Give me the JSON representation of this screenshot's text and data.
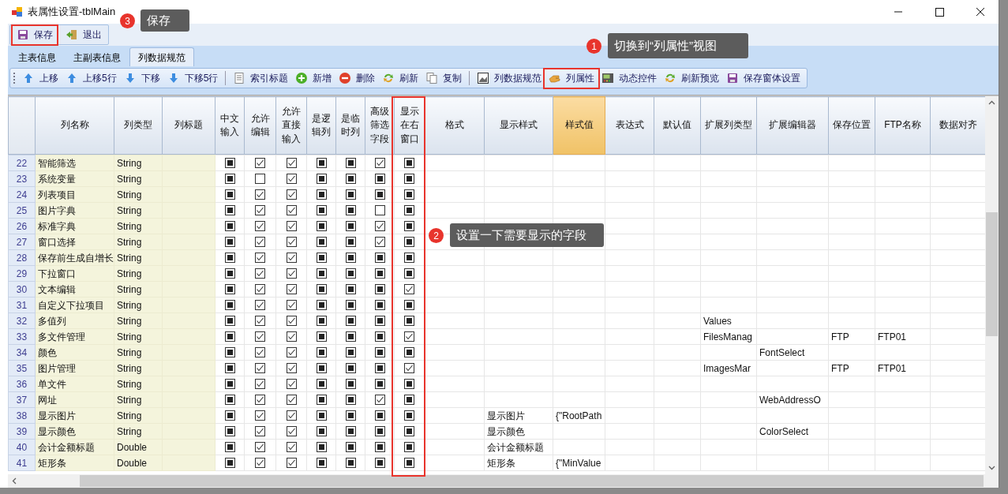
{
  "window": {
    "title": "表属性设置-tblMain"
  },
  "main_toolbar": [
    {
      "label": "保存",
      "kind": "save",
      "highlighted": true
    },
    {
      "label": "退出",
      "kind": "exit",
      "highlighted": false
    }
  ],
  "tabs": [
    {
      "label": "主表信息",
      "selected": false
    },
    {
      "label": "主副表信息",
      "selected": false
    },
    {
      "label": "列数据规范",
      "selected": true
    }
  ],
  "toolbar": [
    {
      "label": "上移",
      "kind": "up",
      "highlighted": false
    },
    {
      "label": "上移5行",
      "kind": "up",
      "highlighted": false
    },
    {
      "label": "下移",
      "kind": "down",
      "highlighted": false
    },
    {
      "label": "下移5行",
      "kind": "down",
      "highlighted": false
    },
    {
      "kind": "separator"
    },
    {
      "label": "索引标题",
      "kind": "doc",
      "highlighted": false
    },
    {
      "label": "新增",
      "kind": "add",
      "highlighted": false
    },
    {
      "label": "删除",
      "kind": "delete",
      "highlighted": false
    },
    {
      "label": "刷新",
      "kind": "refresh",
      "highlighted": false
    },
    {
      "label": "复制",
      "kind": "copy",
      "highlighted": false
    },
    {
      "kind": "separator"
    },
    {
      "label": "列数据规范",
      "kind": "grid",
      "highlighted": false
    },
    {
      "label": "列属性",
      "kind": "hand",
      "highlighted": true
    },
    {
      "label": "动态控件",
      "kind": "panel",
      "highlighted": false
    },
    {
      "label": "刷新预览",
      "kind": "refresh",
      "highlighted": false
    },
    {
      "label": "保存窗体设置",
      "kind": "save",
      "highlighted": false
    }
  ],
  "table": {
    "columns": [
      {
        "label": "列名称",
        "kind": "name",
        "selected": false,
        "highlighted": false
      },
      {
        "label": "列类型",
        "kind": "type",
        "selected": false,
        "highlighted": false
      },
      {
        "label": "列标题",
        "kind": "title",
        "selected": false,
        "highlighted": false
      },
      {
        "label": "中文输入",
        "kind": "check",
        "selected": false,
        "highlighted": false
      },
      {
        "label": "允许编辑",
        "kind": "check",
        "selected": false,
        "highlighted": false
      },
      {
        "label": "允许直接输入",
        "kind": "check",
        "selected": false,
        "highlighted": false
      },
      {
        "label": "是逻辑列",
        "kind": "check",
        "selected": false,
        "highlighted": false
      },
      {
        "label": "是临时列",
        "kind": "check",
        "selected": false,
        "highlighted": false
      },
      {
        "label": "高级筛选字段",
        "kind": "check",
        "selected": false,
        "highlighted": false
      },
      {
        "label": "显示在右窗口",
        "kind": "check",
        "selected": false,
        "highlighted": true
      },
      {
        "label": "格式",
        "kind": "text",
        "selected": false,
        "highlighted": false
      },
      {
        "label": "显示样式",
        "kind": "text",
        "selected": false,
        "highlighted": false
      },
      {
        "label": "样式值",
        "kind": "text",
        "selected": true,
        "highlighted": false
      },
      {
        "label": "表达式",
        "kind": "text",
        "selected": false,
        "highlighted": false
      },
      {
        "label": "默认值",
        "kind": "text",
        "selected": false,
        "highlighted": false
      },
      {
        "label": "扩展列类型",
        "kind": "text",
        "selected": false,
        "highlighted": false
      },
      {
        "label": "扩展编辑器",
        "kind": "text",
        "selected": false,
        "highlighted": false
      },
      {
        "label": "保存位置",
        "kind": "text",
        "selected": false,
        "highlighted": false
      },
      {
        "label": "FTP名称",
        "kind": "text",
        "selected": false,
        "highlighted": false
      },
      {
        "label": "数据对齐",
        "kind": "text",
        "selected": false,
        "highlighted": false
      }
    ],
    "rows": [
      {
        "number": "22",
        "name": "智能筛选",
        "type": "String",
        "checks": [
          {
            "checked": false,
            "indeterminate": true
          },
          {
            "checked": true,
            "indeterminate": false
          },
          {
            "checked": true,
            "indeterminate": false
          },
          {
            "checked": false,
            "indeterminate": true
          },
          {
            "checked": false,
            "indeterminate": true
          },
          {
            "checked": true,
            "indeterminate": false
          },
          {
            "checked": false,
            "indeterminate": true
          }
        ]
      },
      {
        "number": "23",
        "name": "系统变量",
        "type": "String",
        "checks": [
          {
            "checked": false,
            "indeterminate": true
          },
          {
            "checked": false,
            "indeterminate": false
          },
          {
            "checked": true,
            "indeterminate": false
          },
          {
            "checked": false,
            "indeterminate": true
          },
          {
            "checked": false,
            "indeterminate": true
          },
          {
            "checked": false,
            "indeterminate": true
          },
          {
            "checked": false,
            "indeterminate": true
          }
        ]
      },
      {
        "number": "24",
        "name": "列表项目",
        "type": "String",
        "checks": [
          {
            "checked": false,
            "indeterminate": true
          },
          {
            "checked": true,
            "indeterminate": false
          },
          {
            "checked": true,
            "indeterminate": false
          },
          {
            "checked": false,
            "indeterminate": true
          },
          {
            "checked": false,
            "indeterminate": true
          },
          {
            "checked": false,
            "indeterminate": true
          },
          {
            "checked": false,
            "indeterminate": true
          }
        ]
      },
      {
        "number": "25",
        "name": "图片字典",
        "type": "String",
        "checks": [
          {
            "checked": false,
            "indeterminate": true
          },
          {
            "checked": true,
            "indeterminate": false
          },
          {
            "checked": true,
            "indeterminate": false
          },
          {
            "checked": false,
            "indeterminate": true
          },
          {
            "checked": false,
            "indeterminate": true
          },
          {
            "checked": false,
            "indeterminate": false
          },
          {
            "checked": false,
            "indeterminate": true
          }
        ]
      },
      {
        "number": "26",
        "name": "标准字典",
        "type": "String",
        "checks": [
          {
            "checked": false,
            "indeterminate": true
          },
          {
            "checked": true,
            "indeterminate": false
          },
          {
            "checked": true,
            "indeterminate": false
          },
          {
            "checked": false,
            "indeterminate": true
          },
          {
            "checked": false,
            "indeterminate": true
          },
          {
            "checked": true,
            "indeterminate": false
          },
          {
            "checked": false,
            "indeterminate": true
          }
        ]
      },
      {
        "number": "27",
        "name": "窗口选择",
        "type": "String",
        "checks": [
          {
            "checked": false,
            "indeterminate": true
          },
          {
            "checked": true,
            "indeterminate": false
          },
          {
            "checked": true,
            "indeterminate": false
          },
          {
            "checked": false,
            "indeterminate": true
          },
          {
            "checked": false,
            "indeterminate": true
          },
          {
            "checked": true,
            "indeterminate": false
          },
          {
            "checked": false,
            "indeterminate": true
          }
        ]
      },
      {
        "number": "28",
        "name": "保存前生成自增长",
        "type": "String",
        "checks": [
          {
            "checked": false,
            "indeterminate": true
          },
          {
            "checked": true,
            "indeterminate": false
          },
          {
            "checked": true,
            "indeterminate": false
          },
          {
            "checked": false,
            "indeterminate": true
          },
          {
            "checked": false,
            "indeterminate": true
          },
          {
            "checked": false,
            "indeterminate": true
          },
          {
            "checked": false,
            "indeterminate": true
          }
        ]
      },
      {
        "number": "29",
        "name": "下拉窗口",
        "type": "String",
        "checks": [
          {
            "checked": false,
            "indeterminate": true
          },
          {
            "checked": true,
            "indeterminate": false
          },
          {
            "checked": true,
            "indeterminate": false
          },
          {
            "checked": false,
            "indeterminate": true
          },
          {
            "checked": false,
            "indeterminate": true
          },
          {
            "checked": false,
            "indeterminate": true
          },
          {
            "checked": false,
            "indeterminate": true
          }
        ]
      },
      {
        "number": "30",
        "name": "文本编辑",
        "type": "String",
        "checks": [
          {
            "checked": false,
            "indeterminate": true
          },
          {
            "checked": true,
            "indeterminate": false
          },
          {
            "checked": true,
            "indeterminate": false
          },
          {
            "checked": false,
            "indeterminate": true
          },
          {
            "checked": false,
            "indeterminate": true
          },
          {
            "checked": false,
            "indeterminate": true
          },
          {
            "checked": true,
            "indeterminate": false
          }
        ]
      },
      {
        "number": "31",
        "name": "自定义下拉项目",
        "type": "String",
        "checks": [
          {
            "checked": false,
            "indeterminate": true
          },
          {
            "checked": true,
            "indeterminate": false
          },
          {
            "checked": true,
            "indeterminate": false
          },
          {
            "checked": false,
            "indeterminate": true
          },
          {
            "checked": false,
            "indeterminate": true
          },
          {
            "checked": false,
            "indeterminate": true
          },
          {
            "checked": false,
            "indeterminate": true
          }
        ]
      },
      {
        "number": "32",
        "name": "多值列",
        "type": "String",
        "checks": [
          {
            "checked": false,
            "indeterminate": true
          },
          {
            "checked": true,
            "indeterminate": false
          },
          {
            "checked": true,
            "indeterminate": false
          },
          {
            "checked": false,
            "indeterminate": true
          },
          {
            "checked": false,
            "indeterminate": true
          },
          {
            "checked": false,
            "indeterminate": true
          },
          {
            "checked": false,
            "indeterminate": true
          }
        ],
        "ext_type": "Values"
      },
      {
        "number": "33",
        "name": "多文件管理",
        "type": "String",
        "checks": [
          {
            "checked": false,
            "indeterminate": true
          },
          {
            "checked": true,
            "indeterminate": false
          },
          {
            "checked": true,
            "indeterminate": false
          },
          {
            "checked": false,
            "indeterminate": true
          },
          {
            "checked": false,
            "indeterminate": true
          },
          {
            "checked": false,
            "indeterminate": true
          },
          {
            "checked": true,
            "indeterminate": false
          }
        ],
        "ext_type": "FilesManag",
        "save_location": "FTP",
        "ftp_name": "FTP01"
      },
      {
        "number": "34",
        "name": "颜色",
        "type": "String",
        "checks": [
          {
            "checked": false,
            "indeterminate": true
          },
          {
            "checked": true,
            "indeterminate": false
          },
          {
            "checked": true,
            "indeterminate": false
          },
          {
            "checked": false,
            "indeterminate": true
          },
          {
            "checked": false,
            "indeterminate": true
          },
          {
            "checked": false,
            "indeterminate": true
          },
          {
            "checked": false,
            "indeterminate": true
          }
        ],
        "ext_editor": "FontSelect"
      },
      {
        "number": "35",
        "name": "图片管理",
        "type": "String",
        "checks": [
          {
            "checked": false,
            "indeterminate": true
          },
          {
            "checked": true,
            "indeterminate": false
          },
          {
            "checked": true,
            "indeterminate": false
          },
          {
            "checked": false,
            "indeterminate": true
          },
          {
            "checked": false,
            "indeterminate": true
          },
          {
            "checked": false,
            "indeterminate": true
          },
          {
            "checked": true,
            "indeterminate": false
          }
        ],
        "ext_type": "ImagesMar",
        "save_location": "FTP",
        "ftp_name": "FTP01"
      },
      {
        "number": "36",
        "name": "单文件",
        "type": "String",
        "checks": [
          {
            "checked": false,
            "indeterminate": true
          },
          {
            "checked": true,
            "indeterminate": false
          },
          {
            "checked": true,
            "indeterminate": false
          },
          {
            "checked": false,
            "indeterminate": true
          },
          {
            "checked": false,
            "indeterminate": true
          },
          {
            "checked": false,
            "indeterminate": true
          },
          {
            "checked": false,
            "indeterminate": true
          }
        ]
      },
      {
        "number": "37",
        "name": "网址",
        "type": "String",
        "checks": [
          {
            "checked": false,
            "indeterminate": true
          },
          {
            "checked": true,
            "indeterminate": false
          },
          {
            "checked": true,
            "indeterminate": false
          },
          {
            "checked": false,
            "indeterminate": true
          },
          {
            "checked": false,
            "indeterminate": true
          },
          {
            "checked": true,
            "indeterminate": false
          },
          {
            "checked": false,
            "indeterminate": true
          }
        ],
        "ext_editor": "WebAddressO"
      },
      {
        "number": "38",
        "name": "显示图片",
        "type": "String",
        "checks": [
          {
            "checked": false,
            "indeterminate": true
          },
          {
            "checked": true,
            "indeterminate": false
          },
          {
            "checked": true,
            "indeterminate": false
          },
          {
            "checked": false,
            "indeterminate": true
          },
          {
            "checked": false,
            "indeterminate": true
          },
          {
            "checked": false,
            "indeterminate": true
          },
          {
            "checked": false,
            "indeterminate": true
          }
        ],
        "display_style": "显示图片",
        "style_value": "{\"RootPath"
      },
      {
        "number": "39",
        "name": "显示颜色",
        "type": "String",
        "checks": [
          {
            "checked": false,
            "indeterminate": true
          },
          {
            "checked": true,
            "indeterminate": false
          },
          {
            "checked": true,
            "indeterminate": false
          },
          {
            "checked": false,
            "indeterminate": true
          },
          {
            "checked": false,
            "indeterminate": true
          },
          {
            "checked": false,
            "indeterminate": true
          },
          {
            "checked": false,
            "indeterminate": true
          }
        ],
        "display_style": "显示颜色",
        "ext_editor": "ColorSelect"
      },
      {
        "number": "40",
        "name": "会计金额标题",
        "type": "Double",
        "checks": [
          {
            "checked": false,
            "indeterminate": true
          },
          {
            "checked": true,
            "indeterminate": false
          },
          {
            "checked": true,
            "indeterminate": false
          },
          {
            "checked": false,
            "indeterminate": true
          },
          {
            "checked": false,
            "indeterminate": true
          },
          {
            "checked": false,
            "indeterminate": true
          },
          {
            "checked": false,
            "indeterminate": true
          }
        ],
        "display_style": "会计金额标题"
      },
      {
        "number": "41",
        "name": "矩形条",
        "type": "Double",
        "checks": [
          {
            "checked": false,
            "indeterminate": true
          },
          {
            "checked": true,
            "indeterminate": false
          },
          {
            "checked": true,
            "indeterminate": false
          },
          {
            "checked": false,
            "indeterminate": true
          },
          {
            "checked": false,
            "indeterminate": true
          },
          {
            "checked": false,
            "indeterminate": true
          },
          {
            "checked": false,
            "indeterminate": true
          }
        ],
        "display_style": "矩形条",
        "style_value": "{\"MinValue"
      }
    ]
  },
  "annotations": [
    {
      "number": "1",
      "text": "切换到“列属性”视图"
    },
    {
      "number": "2",
      "text": "设置一下需要显示的字段"
    },
    {
      "number": "3",
      "text": "保存"
    }
  ]
}
